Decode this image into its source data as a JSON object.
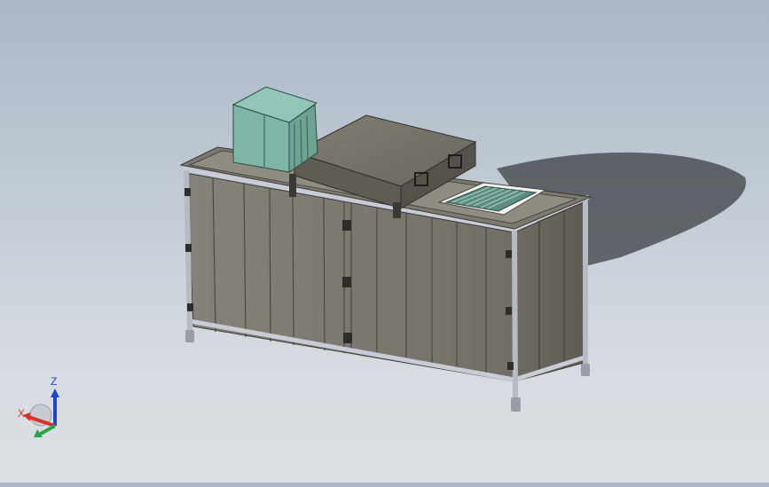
{
  "viewport": {
    "background_top": "#a9b7c7",
    "background_bottom": "#dde0e3",
    "model": {
      "cabinet_panel_color": "#7d7a70",
      "frame_color": "#c9ccd6",
      "lid_color": "#6b685f",
      "tank_color": "#7fb5a7",
      "grid_color": "#5e8c80"
    }
  },
  "triad": {
    "x_label": "X",
    "z_label": "Z",
    "x_color": "#d9302c",
    "y_color": "#2aa24a",
    "z_color": "#1f46c9"
  }
}
